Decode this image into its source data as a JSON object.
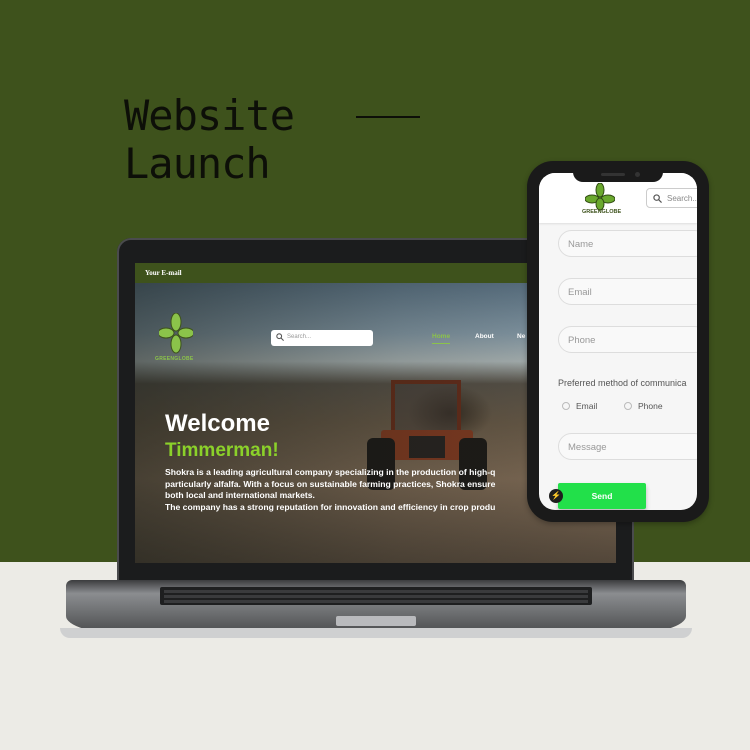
{
  "promo": {
    "headline_line1": "Website",
    "headline_line2": "Launch"
  },
  "laptop_site": {
    "topbar_text": "Your E-mail",
    "logo_text": "GREENGLOBE",
    "search_placeholder": "Search...",
    "nav": [
      "Home",
      "About",
      "Ne"
    ],
    "welcome": "Welcome",
    "name": "Timmerman!",
    "description": "Shokra is a leading agricultural company specializing in the production of high-q\nparticularly alfalfa. With a focus on sustainable farming practices, Shokra ensure\nboth local and international markets.\nThe company has a strong reputation for innovation and efficiency in crop produ"
  },
  "phone_site": {
    "logo_text": "GREENGLOBE",
    "search_placeholder": "Search...",
    "fields": {
      "name": "Name",
      "email": "Email",
      "phone": "Phone",
      "message": "Message"
    },
    "preferred_label": "Preferred method of communica",
    "radio_email": "Email",
    "radio_phone": "Phone",
    "send_label": "Send"
  },
  "colors": {
    "brand_green": "#3e521c",
    "accent_green": "#8bd12a",
    "send_green": "#22e04a"
  },
  "icons": [
    "search-icon",
    "bolt-icon",
    "leaf-logo-icon"
  ]
}
